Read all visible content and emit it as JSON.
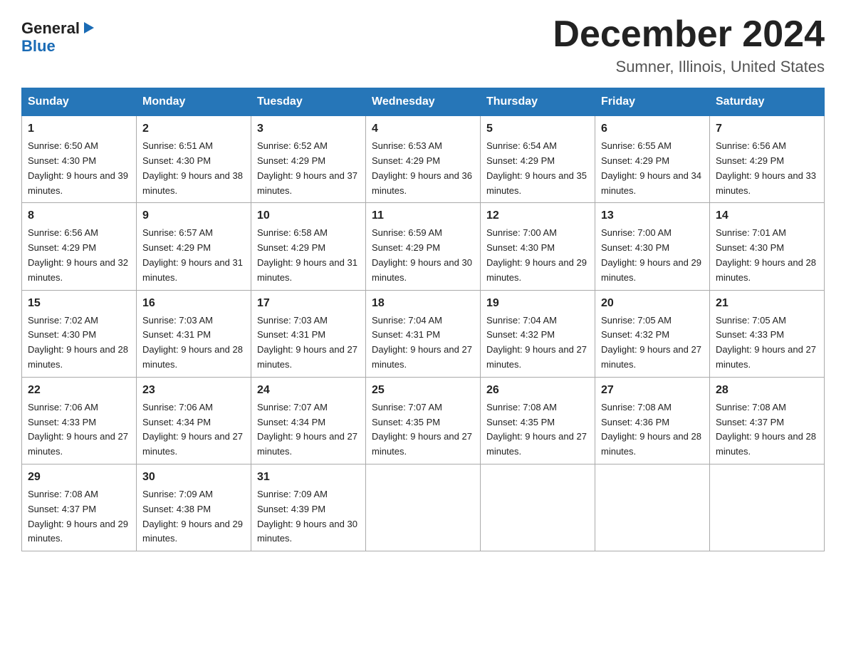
{
  "logo": {
    "general": "General",
    "blue": "Blue",
    "arrow": "▶"
  },
  "title": "December 2024",
  "location": "Sumner, Illinois, United States",
  "headers": [
    "Sunday",
    "Monday",
    "Tuesday",
    "Wednesday",
    "Thursday",
    "Friday",
    "Saturday"
  ],
  "weeks": [
    [
      {
        "date": "1",
        "sunrise": "6:50 AM",
        "sunset": "4:30 PM",
        "daylight": "9 hours and 39 minutes."
      },
      {
        "date": "2",
        "sunrise": "6:51 AM",
        "sunset": "4:30 PM",
        "daylight": "9 hours and 38 minutes."
      },
      {
        "date": "3",
        "sunrise": "6:52 AM",
        "sunset": "4:29 PM",
        "daylight": "9 hours and 37 minutes."
      },
      {
        "date": "4",
        "sunrise": "6:53 AM",
        "sunset": "4:29 PM",
        "daylight": "9 hours and 36 minutes."
      },
      {
        "date": "5",
        "sunrise": "6:54 AM",
        "sunset": "4:29 PM",
        "daylight": "9 hours and 35 minutes."
      },
      {
        "date": "6",
        "sunrise": "6:55 AM",
        "sunset": "4:29 PM",
        "daylight": "9 hours and 34 minutes."
      },
      {
        "date": "7",
        "sunrise": "6:56 AM",
        "sunset": "4:29 PM",
        "daylight": "9 hours and 33 minutes."
      }
    ],
    [
      {
        "date": "8",
        "sunrise": "6:56 AM",
        "sunset": "4:29 PM",
        "daylight": "9 hours and 32 minutes."
      },
      {
        "date": "9",
        "sunrise": "6:57 AM",
        "sunset": "4:29 PM",
        "daylight": "9 hours and 31 minutes."
      },
      {
        "date": "10",
        "sunrise": "6:58 AM",
        "sunset": "4:29 PM",
        "daylight": "9 hours and 31 minutes."
      },
      {
        "date": "11",
        "sunrise": "6:59 AM",
        "sunset": "4:29 PM",
        "daylight": "9 hours and 30 minutes."
      },
      {
        "date": "12",
        "sunrise": "7:00 AM",
        "sunset": "4:30 PM",
        "daylight": "9 hours and 29 minutes."
      },
      {
        "date": "13",
        "sunrise": "7:00 AM",
        "sunset": "4:30 PM",
        "daylight": "9 hours and 29 minutes."
      },
      {
        "date": "14",
        "sunrise": "7:01 AM",
        "sunset": "4:30 PM",
        "daylight": "9 hours and 28 minutes."
      }
    ],
    [
      {
        "date": "15",
        "sunrise": "7:02 AM",
        "sunset": "4:30 PM",
        "daylight": "9 hours and 28 minutes."
      },
      {
        "date": "16",
        "sunrise": "7:03 AM",
        "sunset": "4:31 PM",
        "daylight": "9 hours and 28 minutes."
      },
      {
        "date": "17",
        "sunrise": "7:03 AM",
        "sunset": "4:31 PM",
        "daylight": "9 hours and 27 minutes."
      },
      {
        "date": "18",
        "sunrise": "7:04 AM",
        "sunset": "4:31 PM",
        "daylight": "9 hours and 27 minutes."
      },
      {
        "date": "19",
        "sunrise": "7:04 AM",
        "sunset": "4:32 PM",
        "daylight": "9 hours and 27 minutes."
      },
      {
        "date": "20",
        "sunrise": "7:05 AM",
        "sunset": "4:32 PM",
        "daylight": "9 hours and 27 minutes."
      },
      {
        "date": "21",
        "sunrise": "7:05 AM",
        "sunset": "4:33 PM",
        "daylight": "9 hours and 27 minutes."
      }
    ],
    [
      {
        "date": "22",
        "sunrise": "7:06 AM",
        "sunset": "4:33 PM",
        "daylight": "9 hours and 27 minutes."
      },
      {
        "date": "23",
        "sunrise": "7:06 AM",
        "sunset": "4:34 PM",
        "daylight": "9 hours and 27 minutes."
      },
      {
        "date": "24",
        "sunrise": "7:07 AM",
        "sunset": "4:34 PM",
        "daylight": "9 hours and 27 minutes."
      },
      {
        "date": "25",
        "sunrise": "7:07 AM",
        "sunset": "4:35 PM",
        "daylight": "9 hours and 27 minutes."
      },
      {
        "date": "26",
        "sunrise": "7:08 AM",
        "sunset": "4:35 PM",
        "daylight": "9 hours and 27 minutes."
      },
      {
        "date": "27",
        "sunrise": "7:08 AM",
        "sunset": "4:36 PM",
        "daylight": "9 hours and 28 minutes."
      },
      {
        "date": "28",
        "sunrise": "7:08 AM",
        "sunset": "4:37 PM",
        "daylight": "9 hours and 28 minutes."
      }
    ],
    [
      {
        "date": "29",
        "sunrise": "7:08 AM",
        "sunset": "4:37 PM",
        "daylight": "9 hours and 29 minutes."
      },
      {
        "date": "30",
        "sunrise": "7:09 AM",
        "sunset": "4:38 PM",
        "daylight": "9 hours and 29 minutes."
      },
      {
        "date": "31",
        "sunrise": "7:09 AM",
        "sunset": "4:39 PM",
        "daylight": "9 hours and 30 minutes."
      },
      null,
      null,
      null,
      null
    ]
  ]
}
